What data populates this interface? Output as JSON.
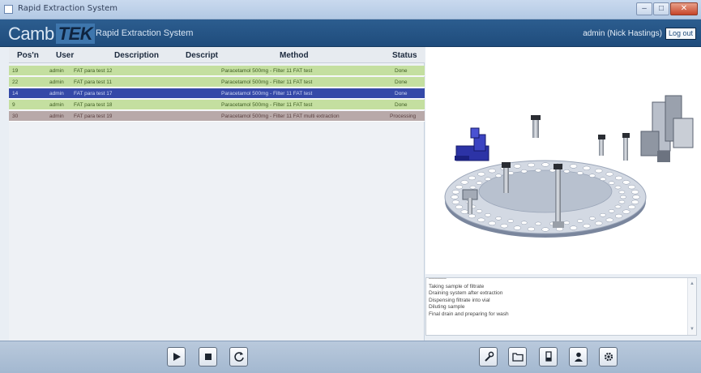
{
  "window": {
    "title": "Rapid Extraction System"
  },
  "header": {
    "logo_part1": "Camb",
    "logo_part2": "TEK",
    "app_title": "Rapid Extraction System",
    "user": "admin (Nick Hastings)",
    "logout_label": "Log out"
  },
  "table": {
    "columns": [
      "Pos'n",
      "User",
      "Description",
      "Descript",
      "Method",
      "Status"
    ],
    "rows": [
      {
        "pos": "19",
        "user": "admin",
        "description": "FAT para test 12",
        "descript": "",
        "method": "Paracetamol 500mg - Filter 11 FAT test",
        "status": "Done",
        "state": "done"
      },
      {
        "pos": "22",
        "user": "admin",
        "description": "FAT para test 11",
        "descript": "",
        "method": "Paracetamol 500mg - Filter 11 FAT test",
        "status": "Done",
        "state": "done"
      },
      {
        "pos": "14",
        "user": "admin",
        "description": "FAT para test 17",
        "descript": "",
        "method": "Paracetamol 500mg - Filter 11 FAT test",
        "status": "Done",
        "state": "selected"
      },
      {
        "pos": "9",
        "user": "admin",
        "description": "FAT para test 18",
        "descript": "",
        "method": "Paracetamol 500mg - Filter 11 FAT test",
        "status": "Done",
        "state": "done"
      },
      {
        "pos": "30",
        "user": "admin",
        "description": "FAT para test 19",
        "descript": "",
        "method": "Paracetamol 500mg - Filter 11 FAT multi extraction",
        "status": "Processing",
        "state": "processing"
      }
    ]
  },
  "log": {
    "lines": [
      "Taking sample of filtrate",
      "Draining system after extraction",
      "Dispensing filtrate into vial",
      "Diluting sample",
      "Final drain and preparing for wash"
    ]
  },
  "toolbar": {
    "left_buttons": [
      "play-icon",
      "stop-icon",
      "refresh-icon"
    ],
    "right_buttons": [
      "wrench-icon",
      "folder-icon",
      "flask-icon",
      "user-icon",
      "gear-icon"
    ]
  },
  "colors": {
    "header": "#1f4c7c",
    "row_done": "#c4dfa0",
    "row_selected": "#3549a8",
    "row_processing": "#b8a9a9",
    "toolbar": "#a3b8d0"
  }
}
